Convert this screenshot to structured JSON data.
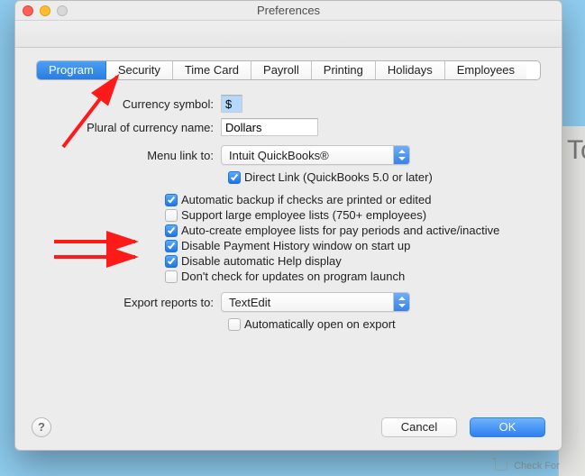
{
  "window": {
    "title": "Preferences"
  },
  "tabs": {
    "items": [
      "Program",
      "Security",
      "Time Card",
      "Payroll",
      "Printing",
      "Holidays",
      "Employees"
    ]
  },
  "fields": {
    "currency_symbol_label": "Currency symbol:",
    "currency_symbol_value": "$",
    "plural_label": "Plural of currency name:",
    "plural_value": "Dollars",
    "menulink_label": "Menu link to:",
    "menulink_value": "Intuit QuickBooks®",
    "directlink_label": "Direct Link (QuickBooks 5.0 or later)",
    "export_label": "Export reports to:",
    "export_value": "TextEdit",
    "autoopen_label": "Automatically open on export"
  },
  "options": {
    "auto_backup": "Automatic backup if checks are printed or edited",
    "large_lists": "Support large employee lists (750+ employees)",
    "auto_create": "Auto-create employee lists for pay periods and active/inactive",
    "disable_hist": "Disable Payment History window on start up",
    "disable_help": "Disable automatic Help display",
    "no_update_chk": "Don't check for updates on program launch"
  },
  "buttons": {
    "cancel": "Cancel",
    "ok": "OK"
  },
  "bg": {
    "checkfor": "Check For",
    "title_hint": "Tc"
  }
}
